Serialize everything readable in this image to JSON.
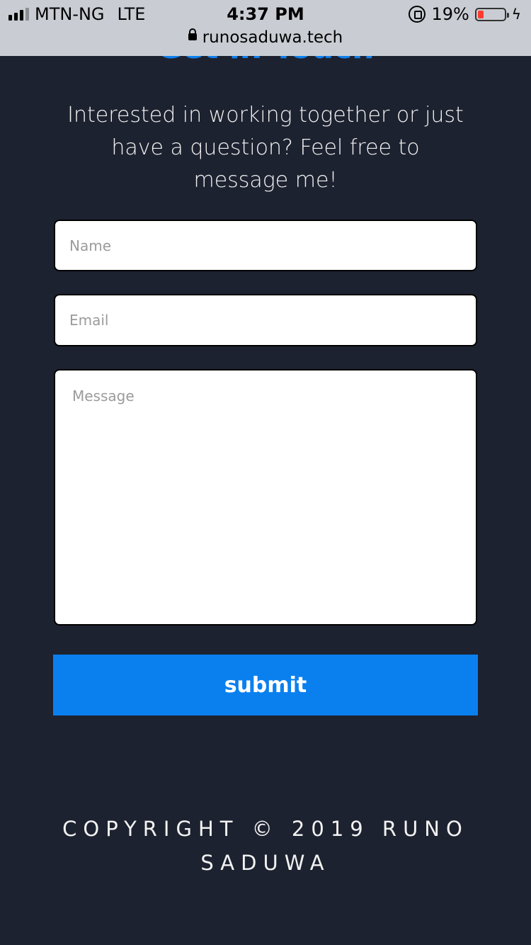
{
  "status_bar": {
    "carrier": "MTN-NG",
    "network": "LTE",
    "time": "4:37 PM",
    "battery_percent": "19%",
    "url": "runosaduwa.tech"
  },
  "section": {
    "heading": "Get in Touch",
    "intro": "Interested in working together or just have a question? Feel free to message me!"
  },
  "form": {
    "name_placeholder": "Name",
    "email_placeholder": "Email",
    "message_placeholder": "Message",
    "submit_label": "submit"
  },
  "footer": {
    "copyright": "COPYRIGHT © 2019 RUNO SADUWA"
  },
  "colors": {
    "background": "#1d2230",
    "accent": "#0a80ef"
  }
}
